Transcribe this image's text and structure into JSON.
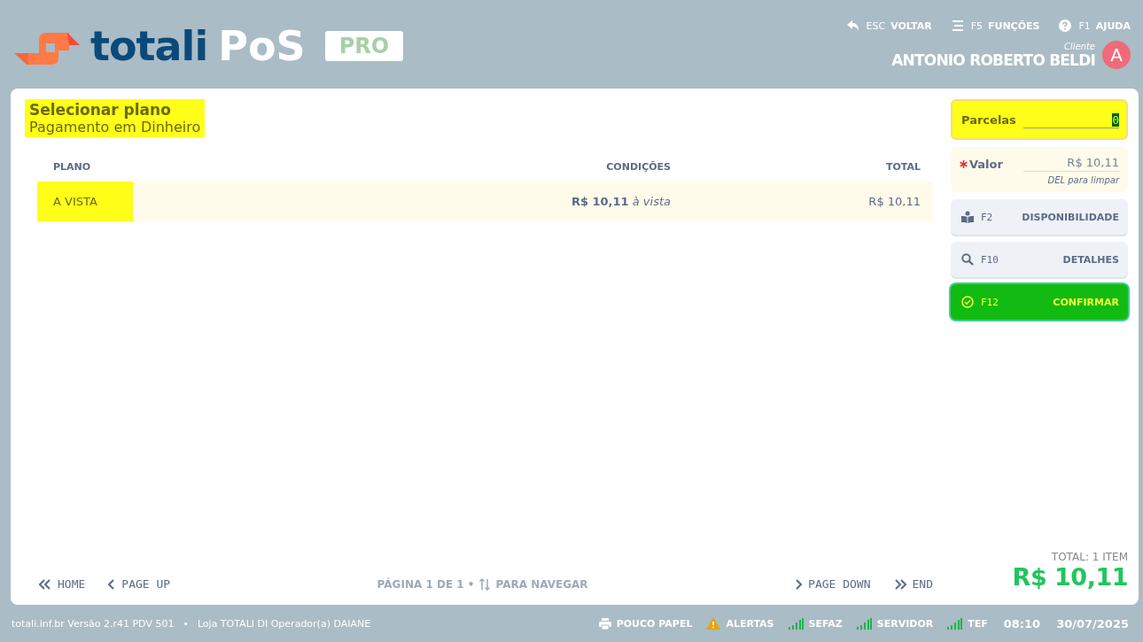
{
  "logo": {
    "word": "totali",
    "product": "PoS",
    "edition": "PRO"
  },
  "top_actions": [
    {
      "kind": "back",
      "key": "ESC",
      "label": "VOLTAR"
    },
    {
      "kind": "menu",
      "key": "F5",
      "label": "FUNÇÕES"
    },
    {
      "kind": "help",
      "key": "F1",
      "label": "AJUDA"
    }
  ],
  "customer": {
    "caption": "Cliente",
    "name": "ANTONIO ROBERTO BELDI",
    "initial": "A"
  },
  "heading": {
    "title": "Selecionar plano",
    "subtitle": "Pagamento em Dinheiro"
  },
  "table": {
    "columns": [
      "PLANO",
      "CONDIÇÕES",
      "TOTAL"
    ],
    "rows": [
      {
        "plan": "A VISTA",
        "conditions": "**R$ 10,11** *à vista*",
        "total": "R$ 10,11",
        "selected": true
      }
    ]
  },
  "pager": {
    "home": "HOME",
    "page_up": "PAGE UP",
    "page_info": "PÁGINA 1 DE 1 •",
    "hint": "PARA NAVEGAR",
    "page_down": "PAGE DOWN",
    "end": "END"
  },
  "parcelas": {
    "label": "Parcelas",
    "value": "0"
  },
  "valor": {
    "label": "Valor",
    "value": "R$ 10,11",
    "hint": "DEL para limpar"
  },
  "actions": [
    {
      "kind": "book",
      "key": "F2",
      "label": "DISPONIBILIDADE"
    },
    {
      "kind": "search",
      "key": "F10",
      "label": "DETALHES"
    },
    {
      "kind": "confirm",
      "key": "F12",
      "label": "CONFIRMAR"
    }
  ],
  "total": {
    "caption": "TOTAL: 1 ITEM",
    "amount": "R$ 10,11"
  },
  "status_bar": {
    "info": "totali.inf.br Versão 2.r41 PDV 501",
    "separator": "•",
    "store": "Loja TOTALI DI Operador(a) DAIANE",
    "items": [
      {
        "kind": "printer",
        "label": "POUCO PAPEL"
      },
      {
        "kind": "warning",
        "label": "ALERTAS"
      },
      {
        "kind": "signal",
        "label": "SEFAZ"
      },
      {
        "kind": "signal",
        "label": "SERVIDOR"
      },
      {
        "kind": "signal",
        "label": "TEF"
      }
    ],
    "time": "08:10",
    "date": "30/07/2025"
  }
}
